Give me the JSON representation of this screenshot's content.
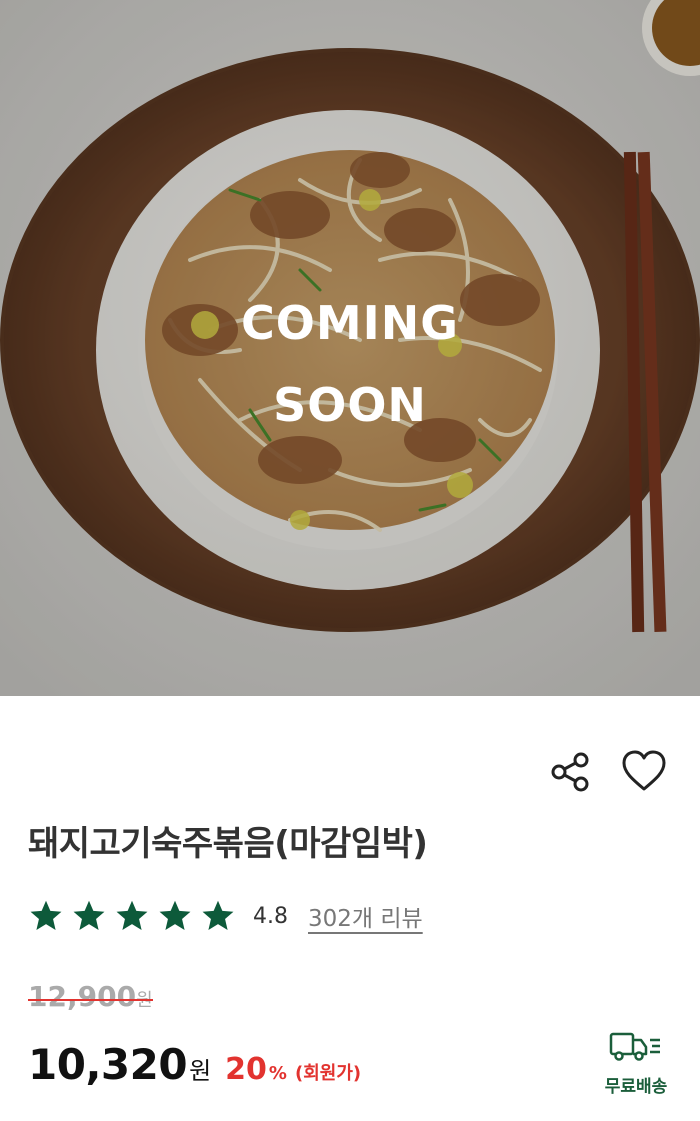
{
  "hero": {
    "status_text_line1": "COMING",
    "status_text_line2": "SOON"
  },
  "product": {
    "title": "돼지고기숙주볶음(마감임박)"
  },
  "rating": {
    "score": "4.8",
    "stars": 5,
    "review_link": "302개 리뷰"
  },
  "pricing": {
    "original_amount": "12,900",
    "original_unit": "원",
    "sale_amount": "10,320",
    "sale_unit": "원",
    "discount": "20",
    "discount_unit": "%",
    "discount_note": "(회원가)"
  },
  "shipping": {
    "label": "무료배송",
    "icon": "truck-icon"
  },
  "actions": {
    "share_icon": "share-icon",
    "wishlist_icon": "heart-icon"
  },
  "colors": {
    "brand_green": "#0d5a3a",
    "discount_red": "#e2332f"
  }
}
